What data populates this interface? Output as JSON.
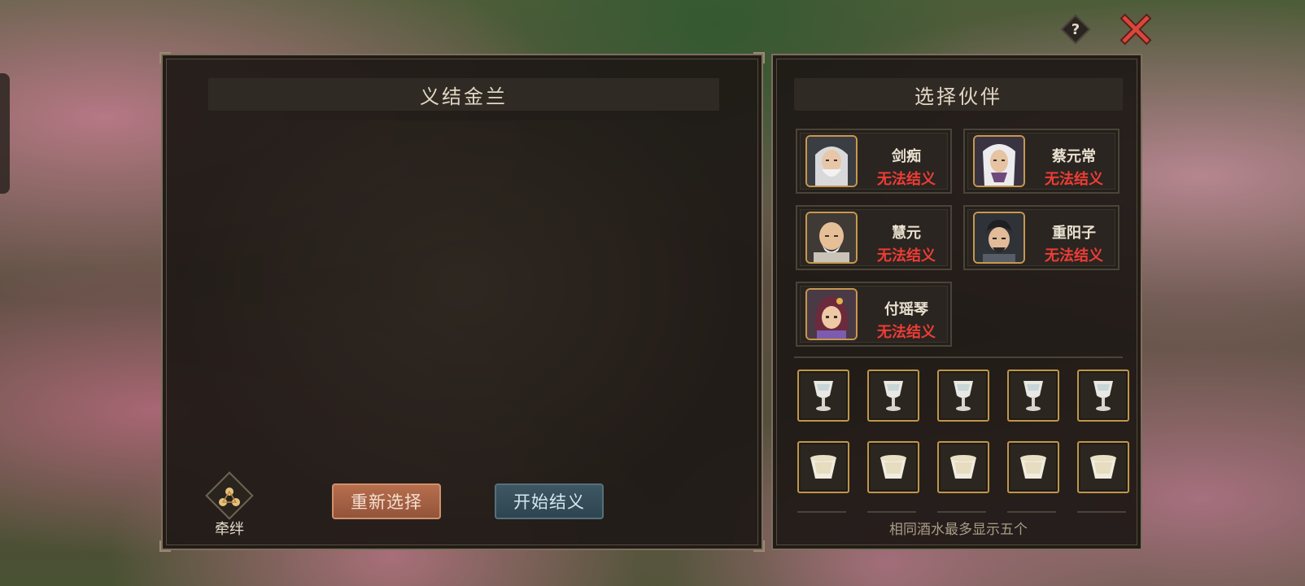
{
  "left_panel": {
    "title": "义结金兰"
  },
  "bond": {
    "label": "牵绊"
  },
  "buttons": {
    "reselect": "重新选择",
    "start": "开始结义"
  },
  "right_panel": {
    "title": "选择伙伴"
  },
  "companions": [
    {
      "name": "剑痴",
      "status": "无法结义"
    },
    {
      "name": "蔡元常",
      "status": "无法结义"
    },
    {
      "name": "慧元",
      "status": "无法结义"
    },
    {
      "name": "重阳子",
      "status": "无法结义"
    },
    {
      "name": "付瑶琴",
      "status": "无法结义"
    }
  ],
  "wine_rows": [
    {
      "icon": "goblet-icon",
      "count": 5
    },
    {
      "icon": "bowl-icon",
      "count": 5
    }
  ],
  "note": "相同酒水最多显示五个",
  "colors": {
    "status_red": "#ee3c36",
    "gold_border": "#c09648",
    "reselect_btn": "#a8613f",
    "start_btn": "#34505c"
  }
}
